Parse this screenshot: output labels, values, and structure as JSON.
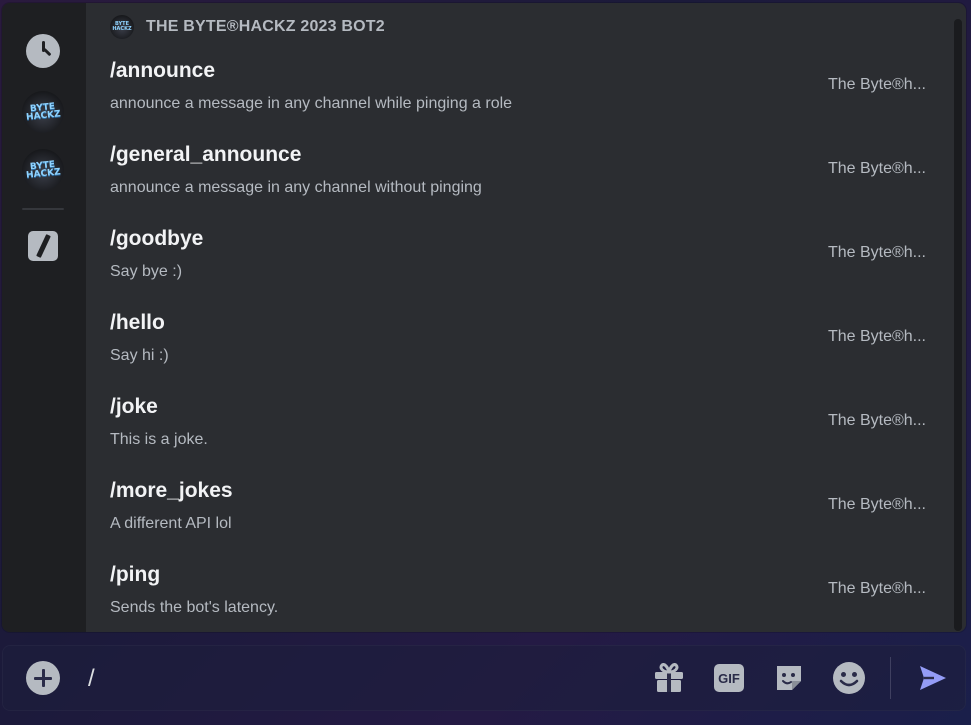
{
  "sidebar": {
    "avatar_text": "BYTE HACKZ",
    "items": [
      {
        "name": "recent",
        "icon": "clock-icon"
      },
      {
        "name": "bot-1",
        "icon": "bot-avatar"
      },
      {
        "name": "bot-2",
        "icon": "bot-avatar"
      },
      {
        "name": "built-in",
        "icon": "slash-command-icon"
      }
    ]
  },
  "section": {
    "title": "THE BYTE®HACKZ 2023 BOT2",
    "avatar_text": "BYTE HACKZ"
  },
  "commands": [
    {
      "name": "/announce",
      "description": "announce a message in any channel while pinging a role",
      "source": "The Byte®h..."
    },
    {
      "name": "/general_announce",
      "description": "announce a message in any channel without pinging",
      "source": "The Byte®h..."
    },
    {
      "name": "/goodbye",
      "description": "Say bye :)",
      "source": "The Byte®h..."
    },
    {
      "name": "/hello",
      "description": "Say hi :)",
      "source": "The Byte®h..."
    },
    {
      "name": "/joke",
      "description": "This is a joke.",
      "source": "The Byte®h..."
    },
    {
      "name": "/more_jokes",
      "description": "A different API lol",
      "source": "The Byte®h..."
    },
    {
      "name": "/ping",
      "description": "Sends the bot's latency.",
      "source": "The Byte®h..."
    }
  ],
  "composer": {
    "value": "/",
    "gif_label": "GIF",
    "icons": [
      "plus-icon",
      "gift-icon",
      "gif-icon",
      "sticker-icon",
      "emoji-icon",
      "send-icon"
    ]
  },
  "colors": {
    "popup_bg": "#2b2d31",
    "rail_bg": "#1e1f22",
    "text_primary": "#f2f3f5",
    "text_muted": "#b5bac1",
    "send_accent": "#949cf7"
  }
}
